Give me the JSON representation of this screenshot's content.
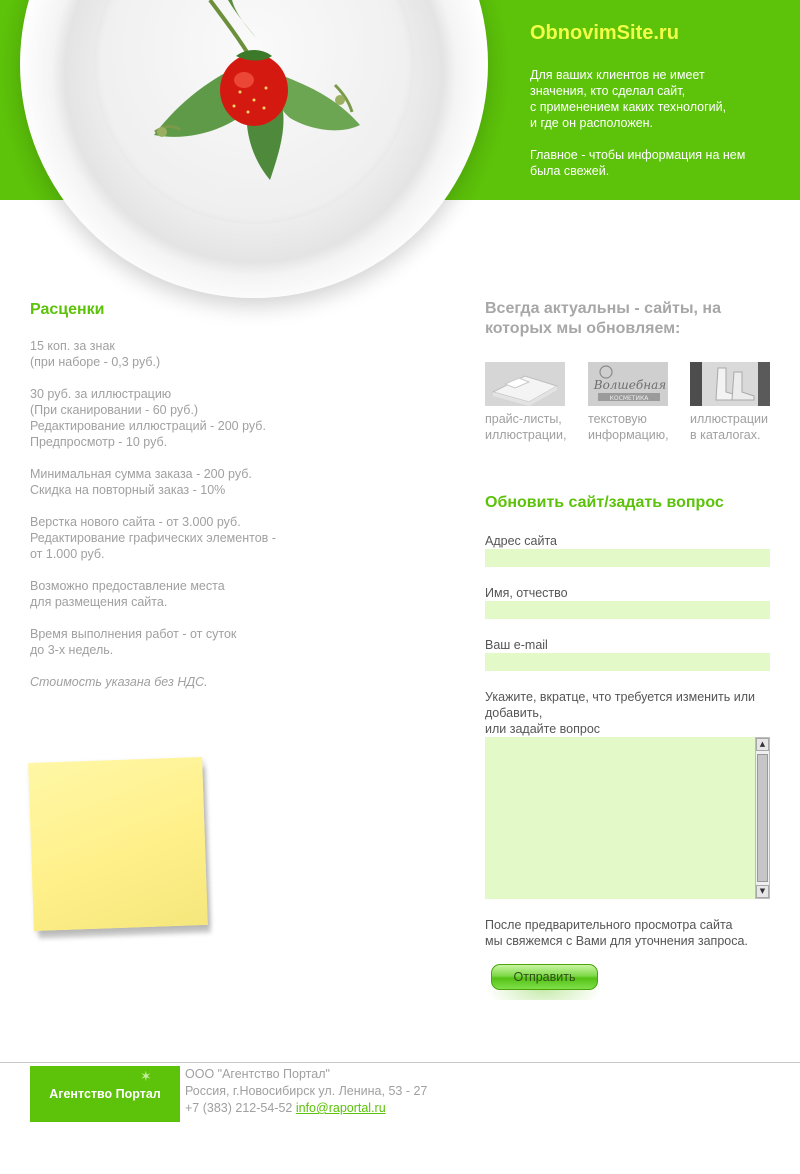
{
  "header": {
    "brand": "ObnovimSite.ru",
    "promo": "Для ваших клиентов не имеет\nзначения, кто сделал сайт,\nс применением каких технологий,\nи где он расположен.\n\nГлавное - чтобы информация на нем\nбыла свежей."
  },
  "prices": {
    "title": "Расценки",
    "paragraphs": [
      "15 коп. за знак\n(при наборе - 0,3 руб.)",
      "30 руб. за иллюстрацию\n(При сканировании - 60 руб.)\nРедактирование иллюстраций - 200 руб.\nПредпросмотр - 10 руб.",
      "Минимальная сумма заказа - 200 руб.\nСкидка на повторный заказ - 10%",
      "Верстка нового сайта - от 3.000 руб.\nРедактирование графических элементов -\nот 1.000 руб.",
      "Возможно предоставление места\nдля размещения сайта.",
      "Время выполнения работ - от суток\nдо 3-х недель."
    ],
    "note": "Стоимость указана без НДС."
  },
  "showcase": {
    "title": "Всегда актуальны - сайты, на которых мы обновляем:",
    "items": [
      {
        "caption": "прайс-листы,\nиллюстрации,"
      },
      {
        "caption": "текстовую\nинформацию,",
        "logo_text": "Волшебная",
        "logo_sub": "КОСМЕТИКА"
      },
      {
        "caption": "иллюстрации\nв каталогах."
      }
    ]
  },
  "form": {
    "title": "Обновить сайт/задать вопрос",
    "site_label": "Адрес сайта",
    "site_value": "",
    "name_label": "Имя, отчество",
    "name_value": "",
    "email_label": "Ваш e-mail",
    "email_value": "",
    "message_label_line1": "Укажите, вкратце, что требуется изменить или",
    "message_label_line2": "добавить,",
    "message_label_line3": "или задайте вопрос",
    "message_value": "",
    "after_text": "После предварительного просмотра сайта\nмы свяжемся с Вами для уточнения запроса.",
    "submit_label": "Отправить"
  },
  "footer": {
    "logo_text": "Агентство Портал",
    "company": "ООО \"Агентство Портал\"",
    "address": "Россия, г.Новосибирск ул. Ленина, 53 - 27",
    "phone": "+7 (383) 212-54-52",
    "email": "info@raportal.ru"
  },
  "colors": {
    "accent_green": "#5cc20a",
    "brand_yellow": "#f2ff48",
    "field_bg": "#e4f9c8",
    "sticky_yellow": "#fff08a"
  }
}
